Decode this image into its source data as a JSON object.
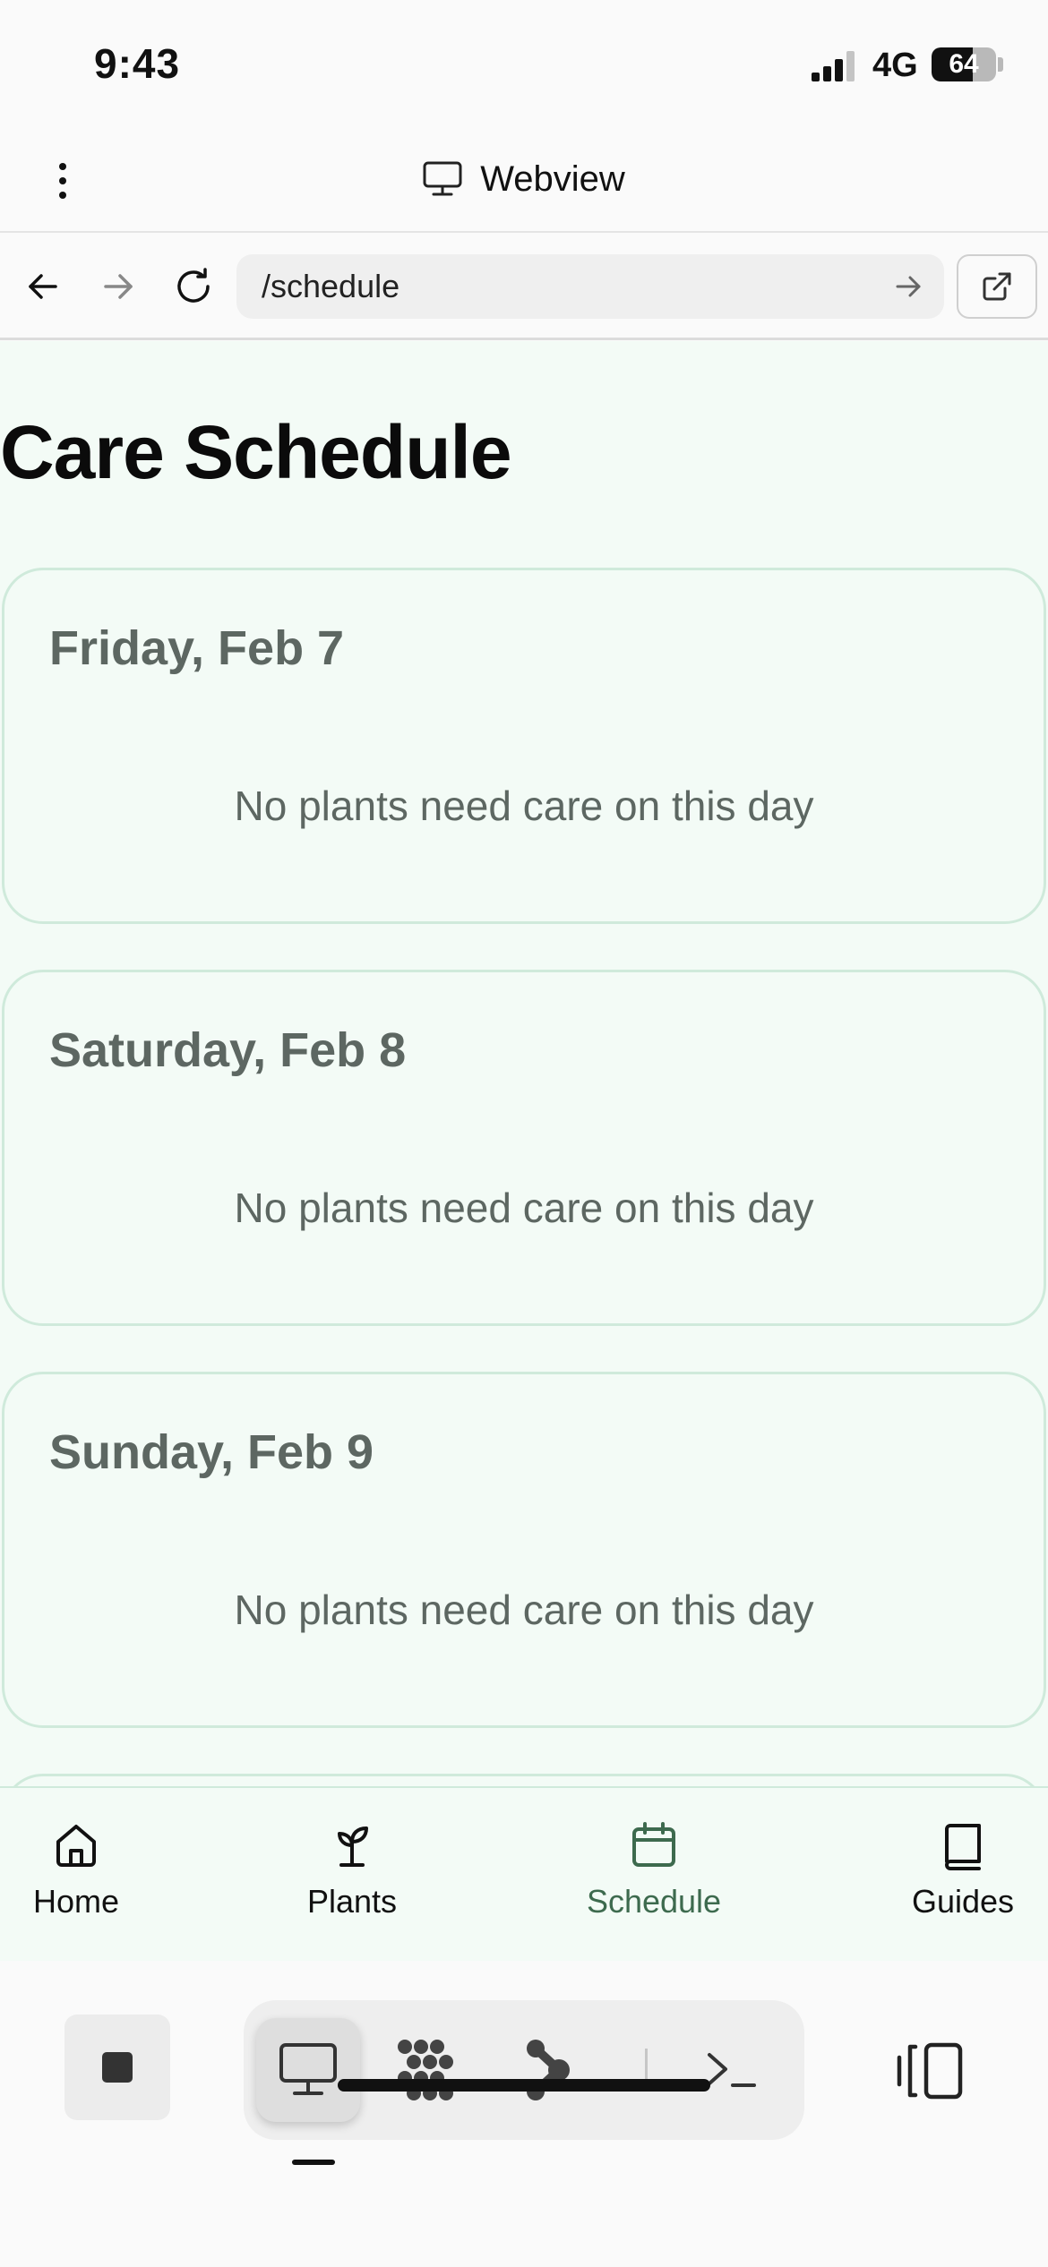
{
  "status_bar": {
    "time": "9:43",
    "network": "4G",
    "battery_level": 64,
    "battery_text": "64"
  },
  "webview_header": {
    "title": "Webview"
  },
  "address_bar": {
    "url": "/schedule"
  },
  "page": {
    "title": "Care Schedule",
    "days": [
      {
        "date": "Friday, Feb 7",
        "message": "No plants need care on this day"
      },
      {
        "date": "Saturday, Feb 8",
        "message": "No plants need care on this day"
      },
      {
        "date": "Sunday, Feb 9",
        "message": "No plants need care on this day"
      }
    ]
  },
  "tab_bar": {
    "active": "Schedule",
    "accent_color": "#3d6a4e",
    "tabs": [
      {
        "label": "Home",
        "icon": "home-icon"
      },
      {
        "label": "Plants",
        "icon": "sprout-icon"
      },
      {
        "label": "Schedule",
        "icon": "calendar-icon"
      },
      {
        "label": "Guides",
        "icon": "book-icon"
      }
    ]
  },
  "dock": {
    "tools": [
      "stop-icon",
      "monitor-icon",
      "dots-grid-icon",
      "branch-icon",
      "terminal-icon",
      "split-view-icon"
    ],
    "active_tool": "monitor-icon"
  },
  "colors": {
    "page_background": "#f3fbf6",
    "card_border": "#cfeadb",
    "muted_text": "#5d6762"
  }
}
